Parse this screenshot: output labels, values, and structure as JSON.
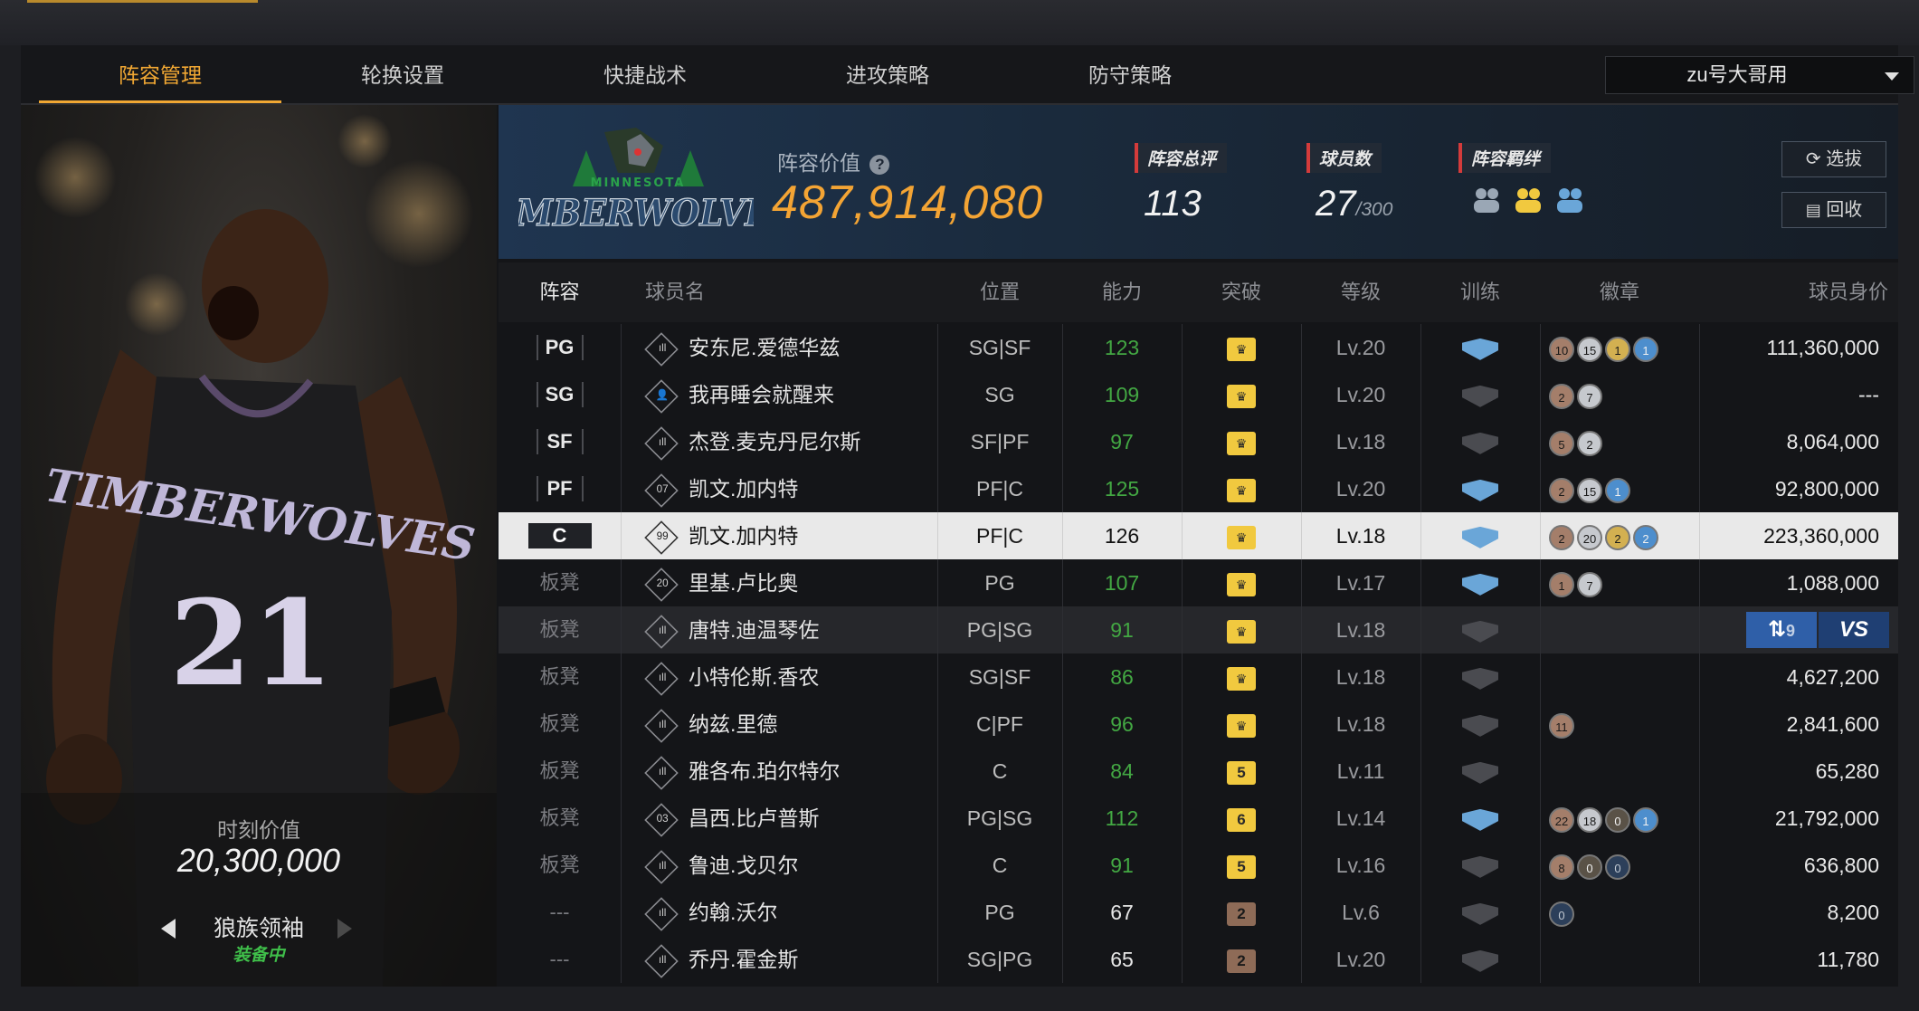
{
  "tabs": [
    "阵容管理",
    "轮换设置",
    "快捷战术",
    "进攻策略",
    "防守策略"
  ],
  "account_selector": "zu号大哥用",
  "card": {
    "moment_value_label": "时刻价值",
    "moment_value": "20,300,000",
    "name": "狼族领袖",
    "status": "装备中",
    "jersey_text": "TIMBERWOLVES",
    "jersey_number": "21"
  },
  "team": {
    "logo_top": "MINNESOTA",
    "logo_main": "TIMBERWOLVES",
    "value_label": "阵容价值",
    "help_icon": "?",
    "value": "487,914,080",
    "overall_label": "阵容总评",
    "overall": "113",
    "players_label": "球员数",
    "players": "27",
    "players_max": "/300",
    "bond_label": "阵容羁绊",
    "select_btn": "选拔",
    "recycle_btn": "回收"
  },
  "columns": [
    "阵容",
    "球员名",
    "位置",
    "能力",
    "突破",
    "等级",
    "训练",
    "徽章",
    "球员身价"
  ],
  "rows": [
    {
      "slot": "PG",
      "icon": "ıll",
      "name": "安东尼.爱德华兹",
      "pos": "SG|SF",
      "rating": "123",
      "brk": "crown",
      "lv": "Lv.20",
      "train": "blue",
      "badges": [
        [
          "10",
          "bronze"
        ],
        [
          "15",
          "silver"
        ],
        [
          "1",
          "gold"
        ],
        [
          "1",
          "blue"
        ]
      ],
      "price": "111,360,000"
    },
    {
      "slot": "SG",
      "icon": "👤",
      "name": "我再睡会就醒来",
      "pos": "SG",
      "rating": "109",
      "brk": "crown",
      "lv": "Lv.20",
      "train": "gray",
      "badges": [
        [
          "2",
          "bronze"
        ],
        [
          "7",
          "silver"
        ]
      ],
      "price": "---"
    },
    {
      "slot": "SF",
      "icon": "ıll",
      "name": "杰登.麦克丹尼尔斯",
      "pos": "SF|PF",
      "rating": "97",
      "brk": "crown",
      "lv": "Lv.18",
      "train": "gray",
      "badges": [
        [
          "5",
          "bronze"
        ],
        [
          "2",
          "silver"
        ]
      ],
      "price": "8,064,000"
    },
    {
      "slot": "PF",
      "icon": "07",
      "name": "凯文.加内特",
      "pos": "PF|C",
      "rating": "125",
      "brk": "crown",
      "lv": "Lv.20",
      "train": "blue",
      "badges": [
        [
          "2",
          "bronze"
        ],
        [
          "15",
          "silver"
        ],
        [
          "1",
          "blue"
        ]
      ],
      "price": "92,800,000"
    },
    {
      "slot": "C",
      "icon": "99",
      "name": "凯文.加内特",
      "pos": "PF|C",
      "rating": "126",
      "brk": "crown",
      "lv": "Lv.18",
      "train": "blue",
      "badges": [
        [
          "2",
          "bronze"
        ],
        [
          "20",
          "silver"
        ],
        [
          "2",
          "gold"
        ],
        [
          "2",
          "blue"
        ]
      ],
      "price": "223,360,000"
    },
    {
      "slot": "板凳",
      "icon": "20",
      "name": "里基.卢比奥",
      "pos": "PG",
      "rating": "107",
      "brk": "crown",
      "lv": "Lv.17",
      "train": "blue",
      "badges": [
        [
          "1",
          "bronze"
        ],
        [
          "7",
          "silver"
        ]
      ],
      "price": "1,088,000"
    },
    {
      "slot": "板凳",
      "icon": "ıll",
      "name": "唐特.迪温琴佐",
      "pos": "PG|SG",
      "rating": "91",
      "brk": "crown",
      "lv": "Lv.18",
      "train": "gray",
      "badges": [],
      "price": ""
    },
    {
      "slot": "板凳",
      "icon": "ıll",
      "name": "小特伦斯.香农",
      "pos": "SG|SF",
      "rating": "86",
      "brk": "crown",
      "lv": "Lv.18",
      "train": "gray",
      "badges": [],
      "price": "4,627,200"
    },
    {
      "slot": "板凳",
      "icon": "ıll",
      "name": "纳兹.里德",
      "pos": "C|PF",
      "rating": "96",
      "brk": "crown",
      "lv": "Lv.18",
      "train": "gray",
      "badges": [
        [
          "11",
          "bronze"
        ]
      ],
      "price": "2,841,600"
    },
    {
      "slot": "板凳",
      "icon": "ıll",
      "name": "雅各布.珀尔特尔",
      "pos": "C",
      "rating": "84",
      "brk": "5",
      "lv": "Lv.11",
      "train": "gray",
      "badges": [],
      "price": "65,280"
    },
    {
      "slot": "板凳",
      "icon": "03",
      "name": "昌西.比卢普斯",
      "pos": "PG|SG",
      "rating": "112",
      "brk": "6",
      "lv": "Lv.14",
      "train": "blue",
      "badges": [
        [
          "22",
          "bronze"
        ],
        [
          "18",
          "silver"
        ],
        [
          "0",
          "dark"
        ],
        [
          "1",
          "blue"
        ]
      ],
      "price": "21,792,000"
    },
    {
      "slot": "板凳",
      "icon": "ıll",
      "name": "鲁迪.戈贝尔",
      "pos": "C",
      "rating": "91",
      "brk": "5",
      "lv": "Lv.16",
      "train": "gray",
      "badges": [
        [
          "8",
          "bronze"
        ],
        [
          "0",
          "dark"
        ],
        [
          "0",
          "navy"
        ]
      ],
      "price": "636,800"
    },
    {
      "slot": "---",
      "icon": "ıll",
      "name": "约翰.沃尔",
      "pos": "PG",
      "rating": "67",
      "brk": "2",
      "lv": "Lv.6",
      "train": "gray",
      "badges": [
        [
          "0",
          "navy"
        ]
      ],
      "price": "8,200"
    },
    {
      "slot": "---",
      "icon": "ıll",
      "name": "乔丹.霍金斯",
      "pos": "SG|PG",
      "rating": "65",
      "brk": "2",
      "lv": "Lv.20",
      "train": "gray",
      "badges": [],
      "price": "11,780"
    }
  ],
  "compare": {
    "swap_glyph": "⇅",
    "peek": "9",
    "vs": "VS"
  },
  "colors": {
    "accent": "#f0a733",
    "value": "#f3a434",
    "rating_green": "#43a843",
    "status_green": "#3fbf4a"
  }
}
